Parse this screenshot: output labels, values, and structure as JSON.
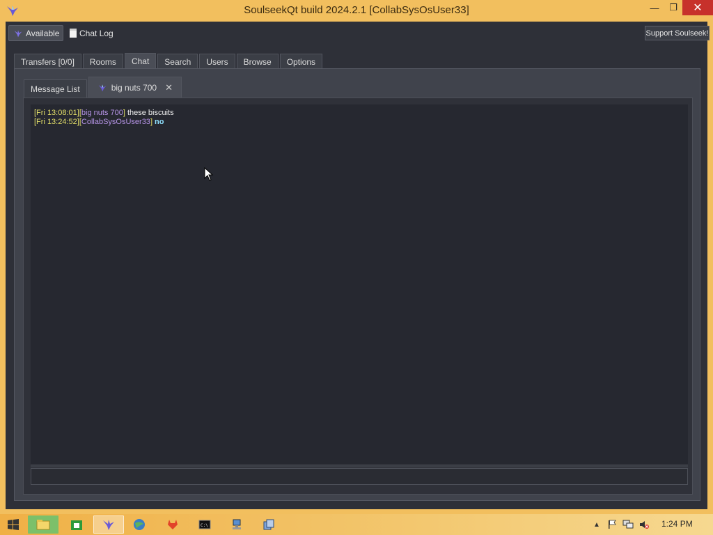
{
  "window": {
    "title": "SoulseekQt build 2024.2.1 [CollabSysOsUser33]",
    "minimize_label": "—",
    "maximize_label": "❐",
    "close_label": "✕"
  },
  "toolbar": {
    "status_label": "Available",
    "chat_log_label": "Chat Log",
    "support_label": "Support Soulseek!"
  },
  "main_tabs": [
    {
      "label": "Transfers [0/0]"
    },
    {
      "label": "Rooms"
    },
    {
      "label": "Chat",
      "active": true
    },
    {
      "label": "Search"
    },
    {
      "label": "Users"
    },
    {
      "label": "Browse"
    },
    {
      "label": "Options"
    }
  ],
  "chat_tabs": {
    "message_list_label": "Message List",
    "active_chat_label": "big nuts 700"
  },
  "messages": [
    {
      "timestamp": "[Fri 13:08:01]",
      "nick_open": "[",
      "nick": "big nuts 700",
      "nick_close": "]",
      "text": " these biscuits"
    },
    {
      "timestamp": "[Fri 13:24:52]",
      "nick_open": "[",
      "nick": "CollabSysOsUser33",
      "nick_close": "]",
      "text": " no"
    }
  ],
  "taskbar": {
    "clock": "1:24 PM"
  },
  "colors": {
    "timestamp": "#e3df69",
    "nick": "#b795e8",
    "self_message": "#8fe1ff",
    "accent_window": "#f2bf5e"
  }
}
